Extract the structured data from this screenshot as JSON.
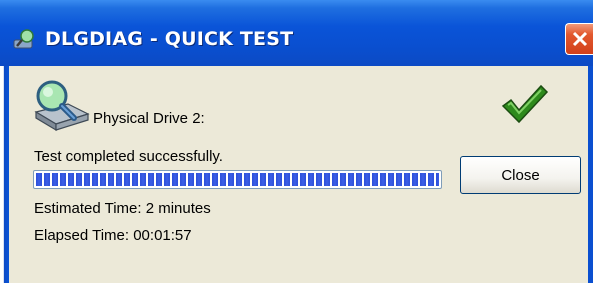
{
  "window": {
    "title": "DLGDIAG - QUICK TEST"
  },
  "drive": {
    "label": "Physical Drive 2:"
  },
  "status": {
    "message": "Test completed successfully."
  },
  "progress": {
    "percent": 100
  },
  "buttons": {
    "close_label": "Close"
  },
  "times": {
    "estimated": "Estimated Time: 2 minutes",
    "elapsed": "Elapsed Time: 00:01:57"
  },
  "icons": {
    "title": "app-diagnostic-icon",
    "drive": "magnifier-drive-icon",
    "status": "green-checkmark-icon",
    "window_close": "close-x-icon"
  },
  "colors": {
    "titlebar": "#0a54d8",
    "close_x": "#d2401b",
    "progress": "#2d4fd8",
    "check": "#2e8a1c"
  }
}
